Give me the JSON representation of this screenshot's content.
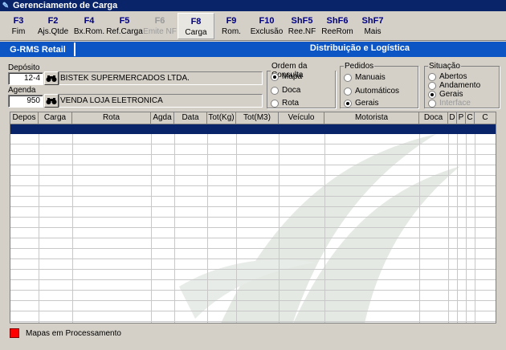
{
  "window": {
    "title": "Gerenciamento de Carga"
  },
  "toolbar": {
    "buttons": [
      {
        "key": "F3",
        "label": "Fim"
      },
      {
        "key": "F2",
        "label": "Ajs.Qtde"
      },
      {
        "key": "F4",
        "label": "Bx.Rom."
      },
      {
        "key": "F5",
        "label": "Ref.Carga"
      },
      {
        "key": "F6",
        "label": "Emite NF"
      },
      {
        "key": "F8",
        "label": "Carga"
      },
      {
        "key": "F9",
        "label": "Rom."
      },
      {
        "key": "F10",
        "label": "Exclusão"
      },
      {
        "key": "ShF5",
        "label": "Ree.NF"
      },
      {
        "key": "ShF6",
        "label": "ReeRom"
      },
      {
        "key": "ShF7",
        "label": "Mais"
      }
    ]
  },
  "banner": {
    "brand": "G-RMS Retail",
    "subtitle": "Distribuição e Logística"
  },
  "deposito": {
    "label": "Depósito",
    "code": "12-4",
    "name": "BISTEK SUPERMERCADOS LTDA."
  },
  "agenda": {
    "label": "Agenda",
    "code": "950",
    "name": "VENDA LOJA ELETRONICA"
  },
  "ordem": {
    "legend": "Ordem da Consulta",
    "options": [
      "Mapa",
      "Doca",
      "Rota"
    ],
    "selected": "Mapa"
  },
  "pedidos": {
    "legend": "Pedidos",
    "options": [
      "Manuais",
      "Automáticos",
      "Gerais"
    ],
    "selected": "Gerais"
  },
  "situacao": {
    "legend": "Situação",
    "options": [
      "Abertos",
      "Andamento",
      "Gerais",
      "Interface"
    ],
    "selected": "Gerais"
  },
  "grid": {
    "columns": [
      "Depos",
      "Carga",
      "Rota",
      "Agda",
      "Data",
      "Tot(Kg)",
      "Tot(M3)",
      "Veículo",
      "Motorista",
      "Doca",
      "D",
      "P",
      "C",
      "C"
    ]
  },
  "footer": {
    "legend_text": "Mapas em Processamento"
  },
  "colors": {
    "selection": "#0a246a",
    "banner": "#0b55c4",
    "legend_red": "#ff0000"
  }
}
